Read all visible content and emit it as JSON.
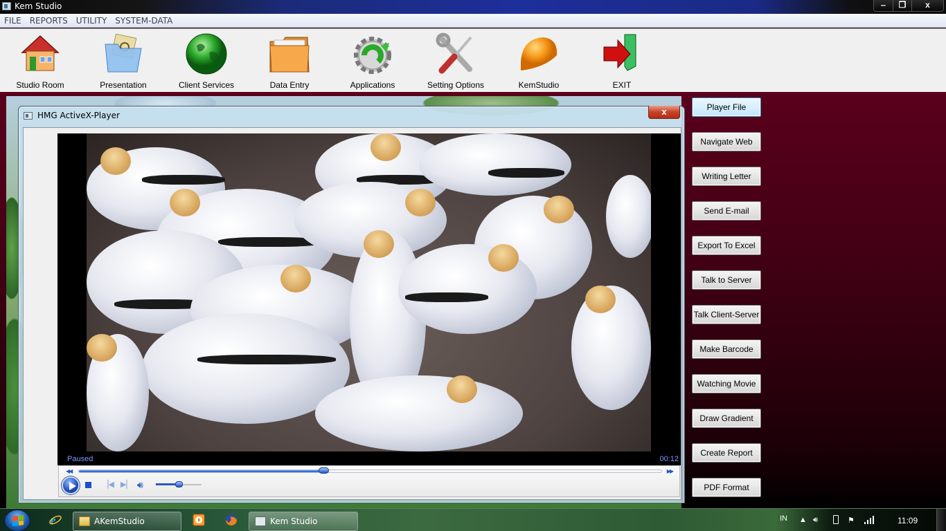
{
  "window": {
    "title": "Kem Studio",
    "controls": {
      "minimize": "‒",
      "restore": "❐",
      "close": "x"
    }
  },
  "menu": [
    "FILE",
    "REPORTS",
    "UTILITY",
    "SYSTEM-DATA"
  ],
  "toolbar": [
    {
      "label": "Studio Room",
      "icon": "house-icon"
    },
    {
      "label": "Presentation",
      "icon": "folder-document-icon"
    },
    {
      "label": "Client Services",
      "icon": "globe-icon"
    },
    {
      "label": "Data Entry",
      "icon": "folder-icon"
    },
    {
      "label": "Applications",
      "icon": "gear-refresh-icon"
    },
    {
      "label": "Setting Options",
      "icon": "tools-icon"
    },
    {
      "label": "KemStudio",
      "icon": "hardhat-icon"
    },
    {
      "label": "EXIT",
      "icon": "exit-door-icon"
    }
  ],
  "player": {
    "title": "HMG ActiveX-Player",
    "close_label": "x",
    "status": "Paused",
    "time": "00:12",
    "seek_progress": 0.42,
    "volume": 0.5
  },
  "side_buttons": [
    "Player File",
    "Navigate Web",
    "Writing Letter",
    "Send E-mail",
    "Export To Excel",
    "Talk to Server",
    "Talk Client-Server",
    "Make Barcode",
    "Watching Movie",
    "Draw Gradient",
    "Create Report",
    "PDF Format"
  ],
  "side_active_index": 0,
  "taskbar": {
    "tasks": [
      {
        "label": "AKemStudio",
        "icon": "folder-icon"
      },
      {
        "label": "Kem Studio",
        "icon": "app-window-icon"
      }
    ],
    "pinned": [
      "internet-explorer-icon",
      "media-player-icon",
      "firefox-icon"
    ],
    "tray": {
      "language": "IN",
      "clock": "11:09"
    }
  },
  "colors": {
    "main_bg_top": "#5a001c",
    "main_bg_bottom": "#000000",
    "player_text": "#7f95ff",
    "accent_blue": "#2558c8"
  }
}
